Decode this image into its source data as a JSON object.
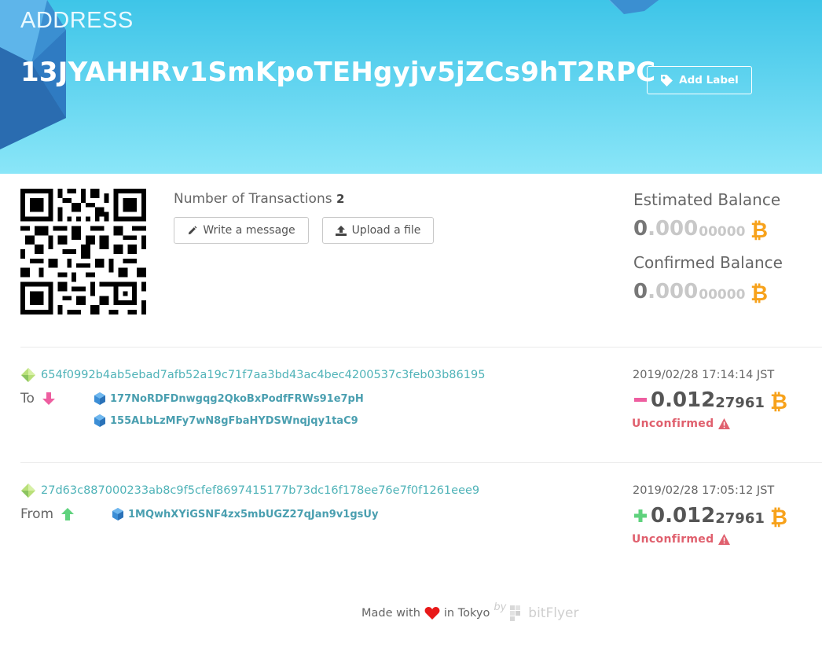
{
  "header": {
    "label": "ADDRESS",
    "address": "13JYAHHRv1SmKpoTEHgyjv5jZCs9hT2RPC",
    "add_label_button": "Add Label"
  },
  "summary": {
    "ntx_label": "Number of Transactions",
    "ntx_value": "2",
    "write_message_button": "Write a message",
    "upload_file_button": "Upload a file"
  },
  "balances": {
    "estimated": {
      "title": "Estimated Balance",
      "int": "0",
      "dec_major": ".000",
      "dec_minor": "00000"
    },
    "confirmed": {
      "title": "Confirmed Balance",
      "int": "0",
      "dec_major": ".000",
      "dec_minor": "00000"
    }
  },
  "transactions": [
    {
      "hash": "654f0992b4ab5ebad7afb52a19c71f7aa3bd43ac4bec4200537c3feb03b86195",
      "direction": "To",
      "addresses": [
        "177NoRDFDnwgqg2QkoBxPodfFRWs91e7pH",
        "155ALbLzMFy7wN8gFbaHYDSWnqjqy1taC9"
      ],
      "time": "2019/02/28 17:14:14 JST",
      "sign": "minus",
      "amount_major": "0.012",
      "amount_minor": "27961",
      "status": "Unconfirmed"
    },
    {
      "hash": "27d63c887000233ab8c9f5cfef8697415177b73dc16f178ee76e7f0f1261eee9",
      "direction": "From",
      "addresses": [
        "1MQwhXYiGSNF4zx5mbUGZ27qJan9v1gsUy"
      ],
      "time": "2019/02/28 17:05:12 JST",
      "sign": "plus",
      "amount_major": "0.012",
      "amount_minor": "27961",
      "status": "Unconfirmed"
    }
  ],
  "footer": {
    "made_with": "Made with",
    "in_tokyo": "in Tokyo",
    "by": "by",
    "brand": "bitFlyer"
  },
  "colors": {
    "accent_teal": "#4fb3b8",
    "bitcoin_orange": "#f7a21b",
    "unconfirmed_red": "#e0606e",
    "send_pink": "#ee5ea0",
    "receive_green": "#5fd27d"
  },
  "icons": [
    "tag-icon",
    "pencil-icon",
    "upload-icon",
    "bitcoin-icon",
    "arrow-down-icon",
    "arrow-up-icon",
    "address-cube-icon",
    "transaction-diamond-icon",
    "warning-icon",
    "heart-icon",
    "bitflyer-logo"
  ]
}
